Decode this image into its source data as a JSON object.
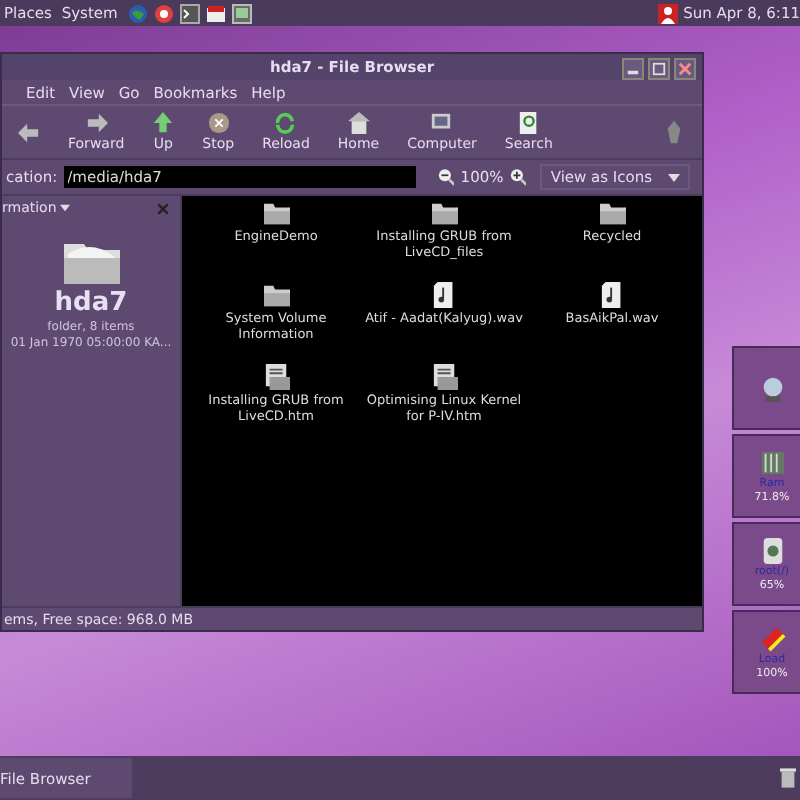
{
  "top_panel": {
    "menus": [
      "Places",
      "System"
    ],
    "clock": "Sun Apr 8, 6:11"
  },
  "window": {
    "title": "hda7 - File Browser",
    "menu": [
      "Edit",
      "View",
      "Go",
      "Bookmarks",
      "Help"
    ],
    "toolbar": [
      {
        "kind": "back"
      },
      {
        "kind": "forward",
        "label": "Forward"
      },
      {
        "kind": "up",
        "label": "Up"
      },
      {
        "kind": "stop",
        "label": "Stop"
      },
      {
        "kind": "reload",
        "label": "Reload"
      },
      {
        "kind": "home",
        "label": "Home"
      },
      {
        "kind": "computer",
        "label": "Computer"
      },
      {
        "kind": "search",
        "label": "Search"
      }
    ],
    "location": {
      "label": "cation:",
      "value": "/media/hda7",
      "zoom": "100%",
      "view": "View as Icons"
    },
    "sidebar": {
      "title": "rmation",
      "name": "hda7",
      "info": "folder, 8 items",
      "date": "01 Jan 1970 05:00:00 KA..."
    },
    "files": [
      {
        "kind": "folder",
        "name": "EngineDemo"
      },
      {
        "kind": "folder",
        "name": "Installing GRUB from LiveCD_files"
      },
      {
        "kind": "folder",
        "name": "Recycled"
      },
      {
        "kind": "folder",
        "name": "System Volume Information"
      },
      {
        "kind": "audio",
        "name": "Atif - Aadat(Kalyug).wav"
      },
      {
        "kind": "audio",
        "name": "BasAikPal.wav"
      },
      {
        "kind": "page",
        "name": "Installing GRUB from LiveCD.htm"
      },
      {
        "kind": "page",
        "name": "Optimising Linux Kernel for P-IV.htm"
      }
    ],
    "status": "ems, Free space: 968.0 MB"
  },
  "widgets": [
    {
      "kind": "network"
    },
    {
      "kind": "ram",
      "label": "Ram",
      "value": "71.8%"
    },
    {
      "kind": "disk",
      "label": "root(/)",
      "value": "65%"
    },
    {
      "kind": "cpu",
      "label": "Load",
      "value": "100%"
    }
  ],
  "taskbar": {
    "task": "File Browser"
  }
}
